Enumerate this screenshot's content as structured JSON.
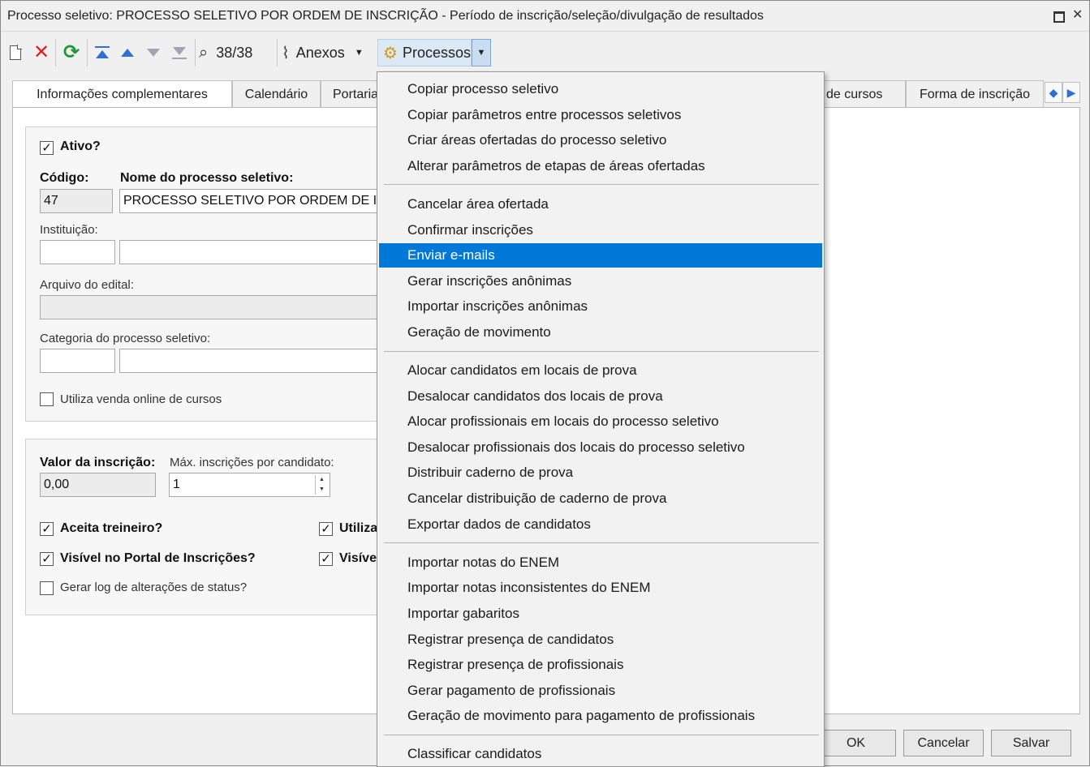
{
  "window": {
    "title": "Processo seletivo: PROCESSO SELETIVO POR ORDEM DE INSCRIÇÃO - Período de inscrição/seleção/divulgação de resultados",
    "maximize_icon": "restore-icon",
    "close_icon": "close-icon",
    "close_glyph": "✕"
  },
  "toolbar": {
    "record_counter": "38/38",
    "attachments_label": "Anexos",
    "processes_label": "Processos",
    "caret": "▼"
  },
  "tabs": [
    {
      "label": "Informações complementares"
    },
    {
      "label": "Calendário"
    },
    {
      "label": "Portaria"
    },
    {
      "label": "de cursos"
    },
    {
      "label": "Forma de inscrição"
    }
  ],
  "form": {
    "active": {
      "label": "Ativo?",
      "checked": true
    },
    "code": {
      "label": "Código:",
      "value": "47"
    },
    "name": {
      "label": "Nome do processo seletivo:",
      "value": "PROCESSO SELETIVO POR ORDEM DE INSCRIÇÃO"
    },
    "institution": {
      "label": "Instituição:",
      "code": "",
      "name": ""
    },
    "edital_file": {
      "label": "Arquivo do edital:",
      "value": ""
    },
    "category": {
      "label": "Categoria do processo seletivo:",
      "code": "",
      "name": ""
    },
    "online_sale": {
      "label": "Utiliza venda online de cursos",
      "checked": false
    },
    "fee": {
      "label": "Valor da inscrição:",
      "value": "0,00"
    },
    "max_per_candidate": {
      "label": "Máx. inscrições por candidato:",
      "value": "1"
    },
    "accepts_trainee": {
      "label": "Aceita treineiro?",
      "checked": true
    },
    "visible_portal": {
      "label": "Visível no Portal de Inscrições?",
      "checked": true
    },
    "status_log": {
      "label": "Gerar log de alterações de status?",
      "checked": false
    },
    "uses_partial": {
      "label": "Utiliza",
      "checked": true
    },
    "visible_partial": {
      "label": "Visível",
      "checked": true
    },
    "check_mark": "✓"
  },
  "buttons": {
    "ok": "OK",
    "cancel": "Cancelar",
    "save": "Salvar"
  },
  "menu": {
    "groups": [
      [
        "Copiar processo seletivo",
        "Copiar parâmetros entre processos seletivos",
        "Criar áreas ofertadas do processo seletivo",
        "Alterar parâmetros de etapas de áreas ofertadas"
      ],
      [
        "Cancelar área ofertada",
        "Confirmar inscrições",
        "Enviar e-mails",
        "Gerar inscrições anônimas",
        "Importar inscrições anônimas",
        "Geração de movimento"
      ],
      [
        "Alocar candidatos em locais de prova",
        "Desalocar candidatos dos locais de prova",
        "Alocar profissionais em locais do processo seletivo",
        "Desalocar profissionais dos locais do processo seletivo",
        "Distribuir caderno de prova",
        "Cancelar distribuição de caderno de prova",
        "Exportar dados de candidatos"
      ],
      [
        "Importar notas do ENEM",
        "Importar notas inconsistentes do ENEM",
        "Importar gabaritos",
        "Registrar presença de candidatos",
        "Registrar presença de profissionais",
        "Gerar pagamento de profissionais",
        "Geração de movimento para pagamento de profissionais"
      ],
      [
        "Classificar candidatos"
      ]
    ],
    "highlighted": "Enviar e-mails",
    "highlight_color": "#0078d7"
  }
}
